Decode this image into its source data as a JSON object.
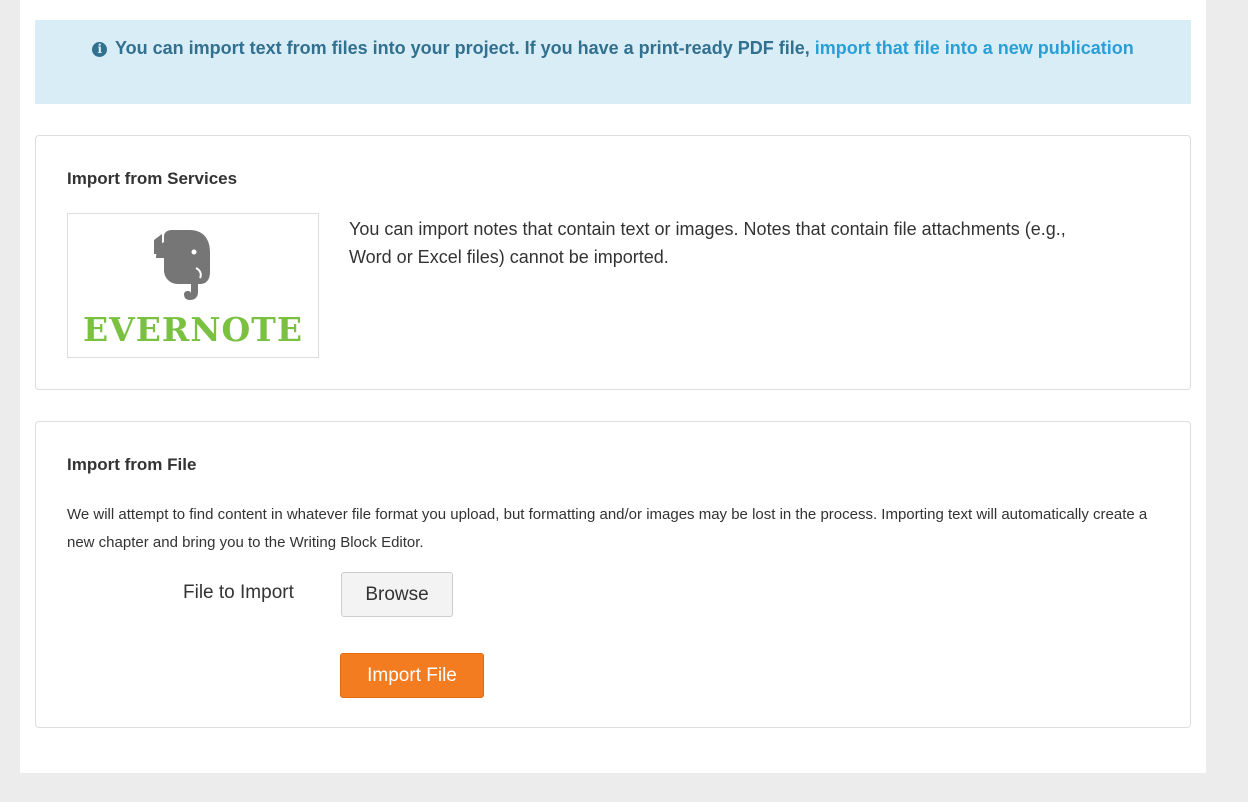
{
  "banner": {
    "icon": "info-circle-icon",
    "text": "You can import text from files into your project. If you have a print-ready PDF file,",
    "link_text": "import that file into a new publication"
  },
  "services": {
    "title": "Import from Services",
    "evernote": {
      "icon": "elephant-icon",
      "wordmark": "EVERNOTE",
      "color": "#7ac142"
    },
    "description": "You can import notes that contain text or images. Notes that contain file attachments (e.g., Word or Excel files) cannot be imported."
  },
  "file_import": {
    "title": "Import from File",
    "description": "We will attempt to find content in whatever file format you upload, but formatting and/or images may be lost in the process. Importing text will automatically create a new chapter and bring you to the Writing Block Editor.",
    "file_label": "File to Import",
    "browse_label": "Browse",
    "import_label": "Import File",
    "accent_color": "#f47c20"
  },
  "colors": {
    "banner_bg": "#d9edf7",
    "banner_text": "#31708f",
    "link": "#2a9fd6"
  }
}
